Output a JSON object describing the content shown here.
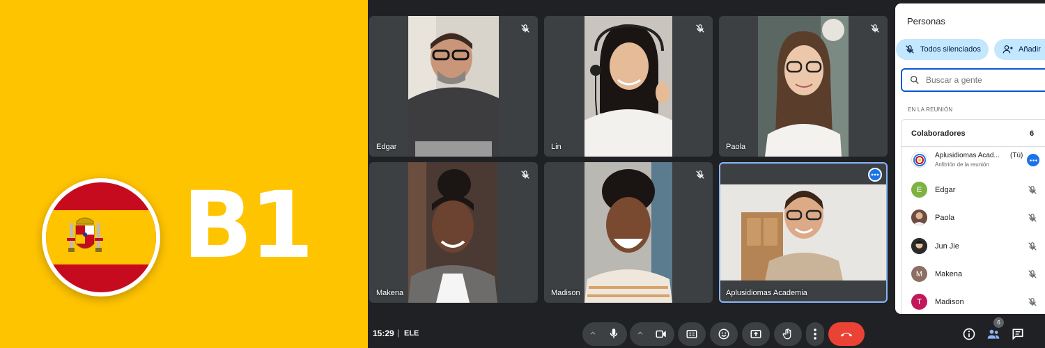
{
  "banner": {
    "level": "B1",
    "accent_color": "#FFC400"
  },
  "tiles": [
    {
      "name": "Edgar",
      "muted": true
    },
    {
      "name": "Lin",
      "muted": true
    },
    {
      "name": "Paola",
      "muted": true
    },
    {
      "name": "Makena",
      "muted": true
    },
    {
      "name": "Madison",
      "muted": true
    },
    {
      "name": "Aplusidiomas Academia",
      "muted": false,
      "active": true
    }
  ],
  "footer": {
    "time": "15:29",
    "separator": "|",
    "meeting_code": "ELE"
  },
  "controls": [
    "caret-up-icon",
    "mic-icon",
    "caret-up-icon",
    "camera-icon",
    "captions-icon",
    "emoji-icon",
    "present-icon",
    "raise-hand-icon",
    "more-vert-icon",
    "end-call-icon"
  ],
  "people_panel": {
    "title": "Personas",
    "mute_all_label": "Todos silenciados",
    "add_label": "Añadir",
    "search_placeholder": "Buscar a gente",
    "section_label": "EN LA REUNIÓN",
    "group_label": "Colaboradores",
    "group_count": "6",
    "host": {
      "name": "Aplusidiomas Acad...",
      "you_label": "(Tú)",
      "role": "Anfitrión de la reunión"
    },
    "participants": [
      {
        "name": "Edgar",
        "initial": "E",
        "color": "#7cb342"
      },
      {
        "name": "Paola",
        "initial": "",
        "color": "#8d6e63"
      },
      {
        "name": "Jun Jie",
        "initial": "",
        "color": "#3e2723"
      },
      {
        "name": "Makena",
        "initial": "M",
        "color": "#8d6e63"
      },
      {
        "name": "Madison",
        "initial": "T",
        "color": "#c2185b"
      }
    ]
  },
  "bottom_right": {
    "people_count": "6"
  }
}
